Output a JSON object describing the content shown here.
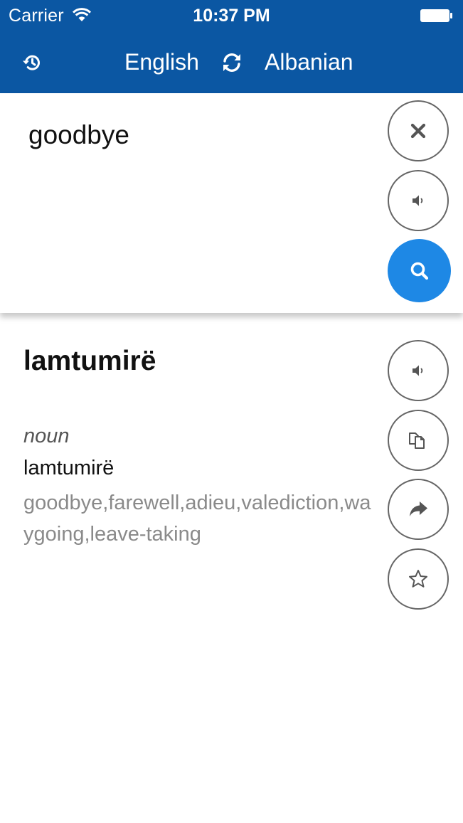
{
  "status_bar": {
    "carrier": "Carrier",
    "time": "10:37 PM"
  },
  "nav": {
    "source_language": "English",
    "target_language": "Albanian",
    "history_icon": "history-icon",
    "swap_icon": "swap-refresh-icon"
  },
  "input": {
    "text": "goodbye",
    "icons": [
      "close-icon",
      "speaker-icon",
      "search-icon"
    ]
  },
  "result": {
    "word": "lamtumirë",
    "part_of_speech": "noun",
    "translation": "lamtumirë",
    "synonyms": "goodbye,farewell,adieu,valediction,waygoing,leave-taking",
    "icons": [
      "speaker-icon",
      "copy-icon",
      "share-icon",
      "star-icon"
    ]
  },
  "colors": {
    "header": "#0b57a3",
    "accent": "#1e88e5",
    "button_border": "#666666",
    "synonym_text": "#8a8a8a"
  }
}
